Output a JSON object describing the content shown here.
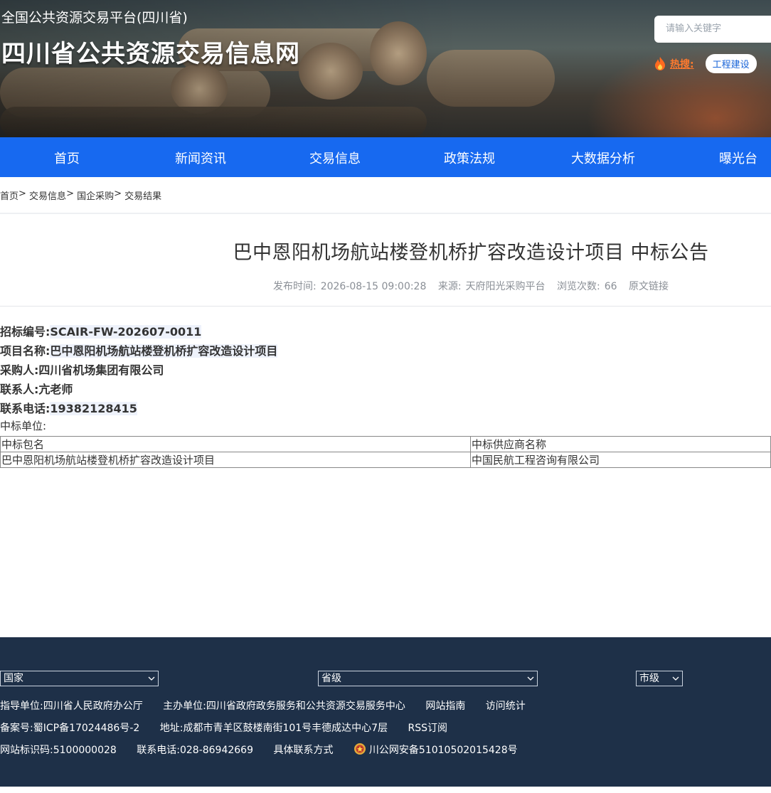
{
  "header": {
    "platform_name": "全国公共资源交易平台(四川省)",
    "site_name": "四川省公共资源交易信息网",
    "search_placeholder": "请输入关键字",
    "hot_label": "热搜:",
    "hot_tag": "工程建设"
  },
  "nav": {
    "items": [
      {
        "label": "首页"
      },
      {
        "label": "新闻资讯"
      },
      {
        "label": "交易信息"
      },
      {
        "label": "政策法规"
      },
      {
        "label": "大数据分析"
      },
      {
        "label": "曝光台"
      }
    ]
  },
  "breadcrumb": [
    "首页",
    "交易信息",
    "国企采购",
    "交易结果"
  ],
  "article": {
    "title": "巴中恩阳机场航站楼登机桥扩容改造设计项目 中标公告",
    "publish_time_label": "发布时间:",
    "publish_time": "2026-08-15 09:00:28",
    "source_label": "来源:",
    "source": "天府阳光采购平台",
    "views_label": "浏览次数:",
    "views": "66",
    "original_link": "原文链接"
  },
  "details": {
    "bid_no_label": "招标编号:",
    "bid_no": "SCAIR-FW-202607-0011",
    "project_label": "项目名称:",
    "project": "巴中恩阳机场航站楼登机桥扩容改造设计项目",
    "buyer_label": "采购人:",
    "buyer": "四川省机场集团有限公司",
    "contact_label": "联系人:",
    "contact": "亢老师",
    "phone_label": "联系电话:",
    "phone": "19382128415",
    "winner_label": "中标单位:"
  },
  "result_table": {
    "headers": [
      "中标包名",
      "中标供应商名称"
    ],
    "rows": [
      [
        "巴中恩阳机场航站楼登机桥扩容改造设计项目",
        "中国民航工程咨询有限公司"
      ]
    ]
  },
  "footer": {
    "select_national": "国家",
    "select_province": "省级",
    "select_city": "市级",
    "guide_unit": "指导单位:四川省人民政府办公厅",
    "host_unit": "主办单位:四川省政府政务服务和公共资源交易服务中心",
    "site_guide": "网站指南",
    "visit_stats": "访问统计",
    "icp": "备案号:蜀ICP备17024486号-2",
    "address": "地址:成都市青羊区鼓楼南街101号丰德成达中心7层",
    "rss": "RSS订阅",
    "site_id": "网站标识码:5100000028",
    "contact_phone": "联系电话:028-86942669",
    "contact_way": "具体联系方式",
    "police_record": "川公网安备51010502015428号"
  },
  "colors": {
    "nav_blue": "#1769f0",
    "footer_navy": "#1e3048",
    "hot_orange": "#ff7a2e"
  }
}
